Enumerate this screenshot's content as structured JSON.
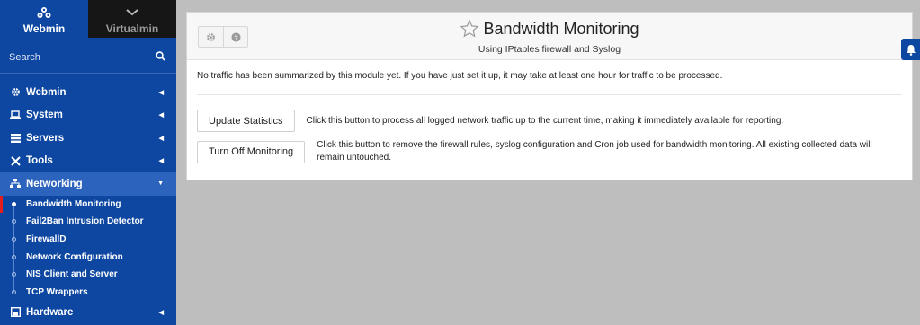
{
  "sidebar": {
    "tabs": [
      {
        "label": "Webmin",
        "icon": "webmin-logo-icon"
      },
      {
        "label": "Virtualmin",
        "icon": "chevron-down-icon"
      }
    ],
    "search_placeholder": "Search",
    "categories": [
      {
        "label": "Webmin",
        "icon": "gear-icon"
      },
      {
        "label": "System",
        "icon": "laptop-icon"
      },
      {
        "label": "Servers",
        "icon": "server-icon"
      },
      {
        "label": "Tools",
        "icon": "tools-icon"
      },
      {
        "label": "Networking",
        "icon": "sitemap-icon"
      },
      {
        "label": "Hardware",
        "icon": "save-icon"
      }
    ],
    "networking_items": [
      "Bandwidth Monitoring",
      "Fail2Ban Intrusion Detector",
      "FirewallD",
      "Network Configuration",
      "NIS Client and Server",
      "TCP Wrappers"
    ],
    "active_item": "Bandwidth Monitoring"
  },
  "header": {
    "title": "Bandwidth Monitoring",
    "subtitle": "Using IPtables firewall and Syslog"
  },
  "main": {
    "notice": "No traffic has been summarized by this module yet. If you have just set it up, it may take at least one hour for traffic to be processed.",
    "actions": [
      {
        "label": "Update Statistics",
        "description": "Click this button to process all logged network traffic up to the current time, making it immediately available for reporting."
      },
      {
        "label": "Turn Off Monitoring",
        "description": "Click this button to remove the firewall rules, syslog configuration and Cron job used for bandwidth monitoring. All existing collected data will remain untouched."
      }
    ]
  },
  "colors": {
    "sidebar": "#0d47a1",
    "sidebar_open": "#2c64bd",
    "active_marker": "#e51d1d",
    "background": "#bebebe"
  }
}
